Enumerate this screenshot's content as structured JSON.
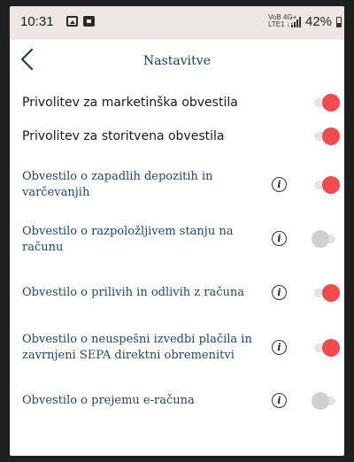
{
  "status_bar": {
    "time": "10:31",
    "icons": [
      "image-notification-icon",
      "message-notification-icon"
    ],
    "network_top": "VoB 4G+",
    "network_bottom": "LTE1 ↓↑",
    "signal_icon": "signal-strength-icon",
    "battery": "42%"
  },
  "header": {
    "back_icon": "back-chevron-icon",
    "title": "Nastavitve"
  },
  "settings": [
    {
      "label": "Privolitev za marketinška obvestila",
      "enabled": true,
      "info": false
    },
    {
      "label": "Privolitev za storitvena obvestila",
      "enabled": true,
      "info": false
    },
    {
      "label": "Obvestilo o zapadlih depozitih in varčevanjih",
      "enabled": true,
      "info": true
    },
    {
      "label": "Obvestilo o razpoložljivem stanju na računu",
      "enabled": false,
      "info": true
    },
    {
      "label": "Obvestilo o prilivih in odlivih z računa",
      "enabled": true,
      "info": true
    },
    {
      "label": "Obvestilo o neuspešni izvedbi plačila in zavrnjeni SEPA direktni obremenitvi",
      "enabled": true,
      "info": true
    },
    {
      "label": "Obvestilo o prejemu e-računa",
      "enabled": false,
      "info": true
    }
  ],
  "info_glyph": "i",
  "colors": {
    "toggle_on": "#f24a4d",
    "toggle_off": "#d0d0d0",
    "title": "#123a5b",
    "label_serif": "#1f4669"
  }
}
